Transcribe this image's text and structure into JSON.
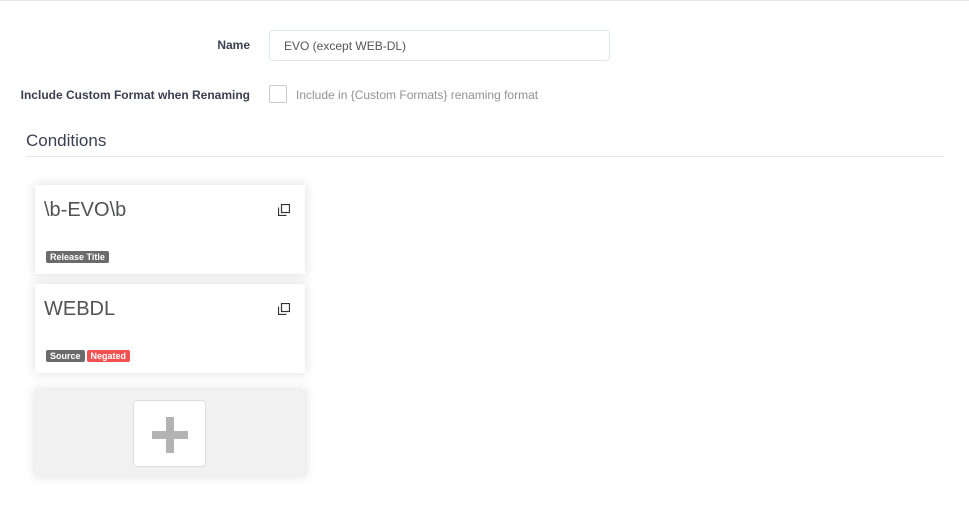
{
  "form": {
    "name_label": "Name",
    "name_value": "EVO (except WEB-DL)",
    "include_label": "Include Custom Format when Renaming",
    "include_checked": false,
    "include_help": "Include in {Custom Formats} renaming format"
  },
  "conditions": {
    "title": "Conditions",
    "items": [
      {
        "name": "\\b-EVO\\b",
        "tags": [
          {
            "label": "Release Title",
            "kind": "default"
          }
        ],
        "icon": "clone-icon"
      },
      {
        "name": "WEBDL",
        "tags": [
          {
            "label": "Source",
            "kind": "default"
          },
          {
            "label": "Negated",
            "kind": "danger"
          }
        ],
        "icon": "clone-icon"
      }
    ],
    "add_icon": "plus-icon"
  },
  "colors": {
    "tag_default": "#6b6b6b",
    "tag_danger": "#f05050",
    "text_dark": "#3a3f51"
  }
}
